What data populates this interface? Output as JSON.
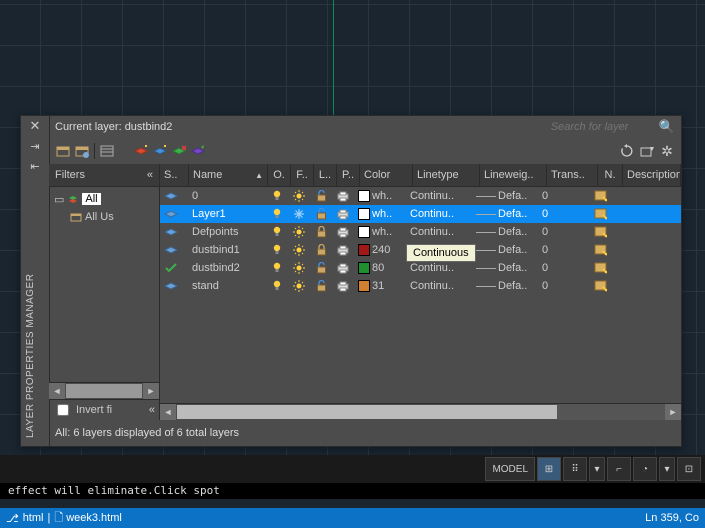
{
  "header": {
    "currentLayerLabel": "Current layer: dustbind2",
    "searchPlaceholder": "Search for layer"
  },
  "verticalTitle": "LAYER PROPERTIES MANAGER",
  "filters": {
    "title": "Filters",
    "invertLabel": "Invert fi",
    "nodes": {
      "all": "All",
      "allUsed": "All Us"
    }
  },
  "columns": {
    "status": "S..",
    "name": "Name",
    "on": "O.",
    "freeze": "F..",
    "lock": "L..",
    "plot": "P..",
    "color": "Color",
    "linetype": "Linetype",
    "lineweight": "Lineweig..",
    "transparency": "Trans..",
    "newvp": "N.",
    "description": "Description"
  },
  "rows": [
    {
      "name": "0",
      "color": "wh..",
      "swatch": "#ffffff",
      "linetype": "Continu..",
      "lineweight": "Defa..",
      "trans": "0",
      "lock": "unlock",
      "current": false
    },
    {
      "name": "Layer1",
      "color": "wh..",
      "swatch": "#ffffff",
      "linetype": "Continu..",
      "lineweight": "Defa..",
      "trans": "0",
      "lock": "unlock",
      "current": false,
      "selected": true
    },
    {
      "name": "Defpoints",
      "color": "wh..",
      "swatch": "#ffffff",
      "linetype": "Continu..",
      "lineweight": "Defa..",
      "trans": "0",
      "lock": "lock",
      "current": false
    },
    {
      "name": "dustbind1",
      "color": "240",
      "swatch": "#a01818",
      "linetype": "Co",
      "lineweight": "Defa..",
      "trans": "0",
      "lock": "lock",
      "current": false
    },
    {
      "name": "dustbind2",
      "color": "80",
      "swatch": "#1f8f2f",
      "linetype": "Continu..",
      "lineweight": "Defa..",
      "trans": "0",
      "lock": "unlock",
      "current": true
    },
    {
      "name": "stand",
      "color": "31",
      "swatch": "#d08030",
      "linetype": "Continu..",
      "lineweight": "Defa..",
      "trans": "0",
      "lock": "unlock",
      "current": false
    }
  ],
  "tooltip": "Continuous",
  "footer": "All: 6 layers displayed of 6 total layers",
  "statusbar": {
    "model": "MODEL"
  },
  "terminal": "effect will eliminate.Click spot",
  "vscode": {
    "left1": "html",
    "left2": "week3.html",
    "right": "Ln 359, Co"
  }
}
